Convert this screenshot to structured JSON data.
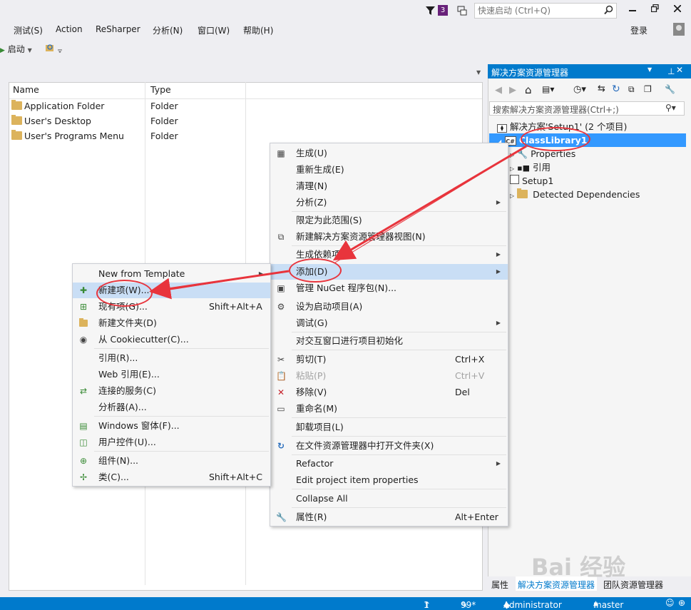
{
  "titlebar": {
    "notification_count": "3",
    "quick_launch_placeholder": "快速启动 (Ctrl+Q)"
  },
  "menubar": {
    "items": [
      "测试(S)",
      "Action",
      "ReSharper",
      "分析(N)",
      "窗口(W)",
      "帮助(H)"
    ],
    "sign_in": "登录"
  },
  "toolbar": {
    "start_label": "启动"
  },
  "file_editor": {
    "columns": [
      "Name",
      "Type"
    ],
    "rows": [
      {
        "name": "Application Folder",
        "type": "Folder"
      },
      {
        "name": "User's Desktop",
        "type": "Folder"
      },
      {
        "name": "User's Programs Menu",
        "type": "Folder"
      }
    ]
  },
  "solution_explorer": {
    "title": "解决方案资源管理器",
    "search_placeholder": "搜索解决方案资源管理器(Ctrl+;)",
    "tree": {
      "solution": "解决方案'Setup1' (2 个项目)",
      "project": "ClassLibrary1",
      "properties": "Properties",
      "references": "引用",
      "setup": "Setup1",
      "detected": "Detected Dependencies"
    },
    "tabs": [
      "属性",
      "解决方案资源管理器",
      "团队资源管理器"
    ]
  },
  "context_menu_main": {
    "items": [
      {
        "label": "生成(U)",
        "icon": "build-icon"
      },
      {
        "label": "重新生成(E)"
      },
      {
        "label": "清理(N)"
      },
      {
        "label": "分析(Z)",
        "submenu": true
      },
      {
        "label": "限定为此范围(S)"
      },
      {
        "label": "新建解决方案资源管理器视图(N)",
        "icon": "new-view-icon"
      },
      {
        "label": "生成依赖项(B)",
        "submenu": true
      },
      {
        "label": "添加(D)",
        "submenu": true,
        "highlighted": true
      },
      {
        "label": "管理 NuGet 程序包(N)...",
        "icon": "nuget-icon"
      },
      {
        "label": "设为启动项目(A)",
        "icon": "gear-icon"
      },
      {
        "label": "调试(G)",
        "submenu": true
      },
      {
        "label": "对交互窗口进行项目初始化"
      },
      {
        "label": "剪切(T)",
        "shortcut": "Ctrl+X",
        "icon": "scissors-icon"
      },
      {
        "label": "粘贴(P)",
        "shortcut": "Ctrl+V",
        "icon": "paste-icon",
        "disabled": true
      },
      {
        "label": "移除(V)",
        "shortcut": "Del",
        "icon": "remove-icon"
      },
      {
        "label": "重命名(M)",
        "icon": "rename-icon"
      },
      {
        "label": "卸载项目(L)"
      },
      {
        "label": "在文件资源管理器中打开文件夹(X)",
        "icon": "open-folder-icon"
      },
      {
        "label": "Refactor",
        "submenu": true
      },
      {
        "label": "Edit project item properties"
      },
      {
        "label": "Collapse All"
      },
      {
        "label": "属性(R)",
        "shortcut": "Alt+Enter",
        "icon": "wrench-icon"
      }
    ]
  },
  "context_menu_add": {
    "items": [
      {
        "label": "New from Template",
        "submenu": true
      },
      {
        "label": "新建项(W)...",
        "icon": "new-item-icon",
        "highlighted": true
      },
      {
        "label": "现有项(G)...",
        "shortcut": "Shift+Alt+A",
        "icon": "existing-item-icon"
      },
      {
        "label": "新建文件夹(D)",
        "icon": "new-folder-icon"
      },
      {
        "label": "从 Cookiecutter(C)...",
        "icon": "cookiecutter-icon"
      },
      {
        "label": "引用(R)..."
      },
      {
        "label": "Web 引用(E)..."
      },
      {
        "label": "连接的服务(C)",
        "icon": "connected-service-icon"
      },
      {
        "label": "分析器(A)..."
      },
      {
        "label": "Windows 窗体(F)...",
        "icon": "windows-form-icon"
      },
      {
        "label": "用户控件(U)...",
        "icon": "user-control-icon"
      },
      {
        "label": "组件(N)...",
        "icon": "component-icon"
      },
      {
        "label": "类(C)...",
        "shortcut": "Shift+Alt+C",
        "icon": "class-icon"
      }
    ]
  },
  "statusbar": {
    "up": "1",
    "edits": "99*",
    "user": "Administrator",
    "branch": "master"
  },
  "colors": {
    "accent": "#007acc",
    "highlight": "#c9def5",
    "annotation": "#e8343c"
  },
  "watermark": "Bai 经验"
}
